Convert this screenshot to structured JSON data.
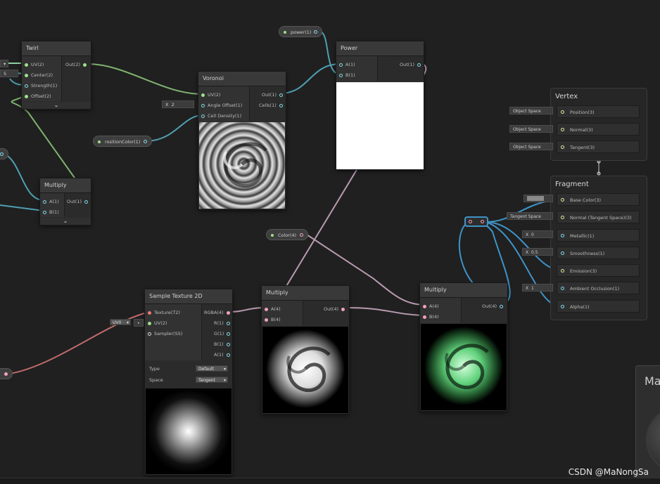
{
  "nodes": {
    "twirl": {
      "title": "Twirl",
      "inputs": [
        "UV(2)",
        "Center(2)",
        "Strength(1)",
        "Offset(2)"
      ],
      "output": "Out(2)",
      "center_field": "5"
    },
    "voronoi": {
      "title": "Voronoi",
      "inputs": [
        "UV(2)",
        "Angle Offset(1)",
        "Cell Density(1)"
      ],
      "outputs": [
        "Out(1)",
        "Cells(1)"
      ],
      "angle_field_label": "X",
      "angle_field_value": "2"
    },
    "power": {
      "title": "Power",
      "inputs": [
        "A(1)",
        "B(1)"
      ],
      "output": "Out(1)"
    },
    "multiply_small": {
      "title": "Multiply",
      "inputs": [
        "A(1)",
        "B(1)"
      ],
      "output": "Out(1)"
    },
    "sample_texture": {
      "title": "Sample Texture 2D",
      "inputs": [
        "Texture(T2)",
        "UV(2)",
        "Sampler(SS)"
      ],
      "outputs": [
        "RGBA(4)",
        "R(1)",
        "G(1)",
        "B(1)",
        "A(1)"
      ],
      "uv_dropdown": "UV0",
      "type_label": "Type",
      "type_value": "Default",
      "space_label": "Space",
      "space_value": "Tangent"
    },
    "multiply_mid": {
      "title": "Multiply",
      "inputs": [
        "A(4)",
        "B(4)"
      ],
      "output": "Out(4)"
    },
    "multiply_right": {
      "title": "Multiply",
      "inputs": [
        "A(4)",
        "B(4)"
      ],
      "output": "Out(4)"
    }
  },
  "properties": {
    "power": "power(1)",
    "position_color": "rositionColor(1)",
    "color": "Color(4)"
  },
  "master": {
    "vertex_title": "Vertex",
    "vertex_rows": [
      {
        "label": "Position(3)",
        "field": "Object Space"
      },
      {
        "label": "Normal(3)",
        "field": "Object Space"
      },
      {
        "label": "Tangent(3)",
        "field": "Object Space"
      }
    ],
    "fragment_title": "Fragment",
    "fragment_rows": [
      {
        "label": "Base Color(3)",
        "field": ""
      },
      {
        "label": "Normal (Tangent Space)(3)",
        "field": "Tangent Space"
      },
      {
        "label": "Metallic(1)",
        "field_x": "X",
        "field": "0"
      },
      {
        "label": "Smoothness(1)",
        "field_x": "X",
        "field": "0.5"
      },
      {
        "label": "Emission(3)",
        "field": ""
      },
      {
        "label": "Ambient Occlusion(1)",
        "field_x": "X",
        "field": "1"
      },
      {
        "label": "Alpha(1)",
        "field": ""
      }
    ],
    "preview_label": "Ma"
  },
  "watermark": "CSDN @MaNongSa",
  "colors": {
    "background": "#202020",
    "wire_green": "#7fb36e",
    "wire_teal": "#4f9fb1",
    "wire_pink": "#b99ab0",
    "wire_red": "#c06a6a",
    "wire_blue": "#3f93c8"
  }
}
